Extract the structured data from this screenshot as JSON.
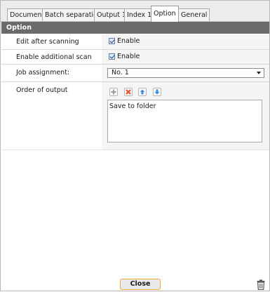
{
  "tabs": [
    {
      "label": "Document"
    },
    {
      "label": "Batch separation"
    },
    {
      "label": "Output 1"
    },
    {
      "label": "Index 1"
    },
    {
      "label": "Option",
      "active": true
    },
    {
      "label": "General"
    }
  ],
  "section": {
    "title": "Option"
  },
  "rows": {
    "edit_after_scanning": {
      "label": "Edit after scanning",
      "checkbox_label": "Enable",
      "checked": true
    },
    "enable_additional_scan": {
      "label": "Enable additional scan",
      "checkbox_label": "Enable",
      "checked": true
    },
    "job_assignment": {
      "label": "Job assignment:",
      "value": "No. 1"
    },
    "order_of_output": {
      "label": "Order of output",
      "toolbar": [
        "add-icon",
        "delete-icon",
        "move-up-icon",
        "move-down-icon"
      ],
      "items": [
        "Save to folder"
      ]
    }
  },
  "footer": {
    "close_label": "Close",
    "trash_icon": "trash-icon"
  },
  "colors": {
    "header_bg": "#6a6a6a",
    "close_border": "#f0a83f",
    "accent_blue": "#3d8fe0",
    "delete_red": "#e8542d"
  }
}
